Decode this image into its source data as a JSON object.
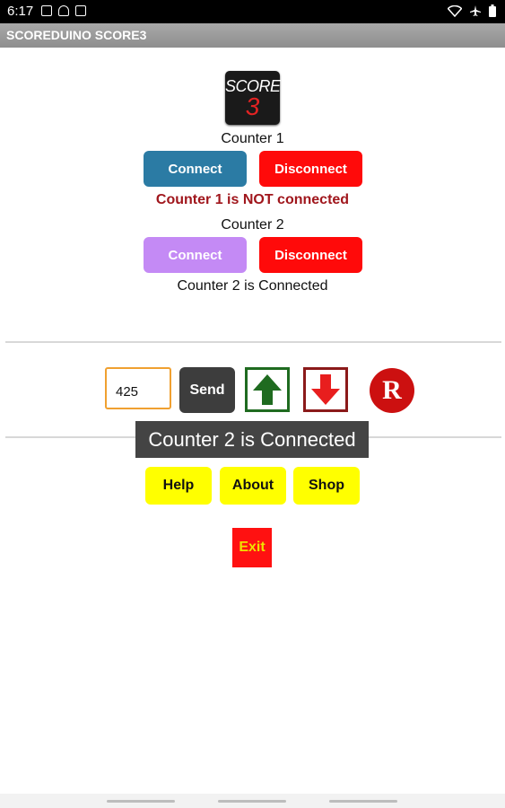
{
  "status_bar": {
    "time": "6:17"
  },
  "app": {
    "title": "SCOREDUINO SCORE3"
  },
  "logo": {
    "line1": "SCORE",
    "line2": "3"
  },
  "counter1": {
    "label": "Counter 1",
    "connect_label": "Connect",
    "disconnect_label": "Disconnect",
    "status": "Counter 1 is NOT connected"
  },
  "counter2": {
    "label": "Counter 2",
    "connect_label": "Connect",
    "disconnect_label": "Disconnect",
    "status": "Counter 2 is Connected"
  },
  "controls": {
    "score_value": "425",
    "send_label": "Send",
    "reset_label": "R"
  },
  "toast": {
    "message": "Counter 2 is Connected"
  },
  "menu": {
    "help_label": "Help",
    "about_label": "About",
    "shop_label": "Shop",
    "exit_label": "Exit"
  },
  "colors": {
    "connect1": "#2b7ba4",
    "connect2": "#c48af5",
    "disconnect": "#ff0a0a",
    "status_error": "#a0161c",
    "menu_yellow": "#ffff00",
    "exit_red": "#ff1111"
  },
  "icons": [
    "image-icon",
    "android-icon",
    "checkbox-icon",
    "wifi-icon",
    "airplane-icon",
    "battery-icon",
    "up-arrow-icon",
    "down-arrow-icon"
  ]
}
